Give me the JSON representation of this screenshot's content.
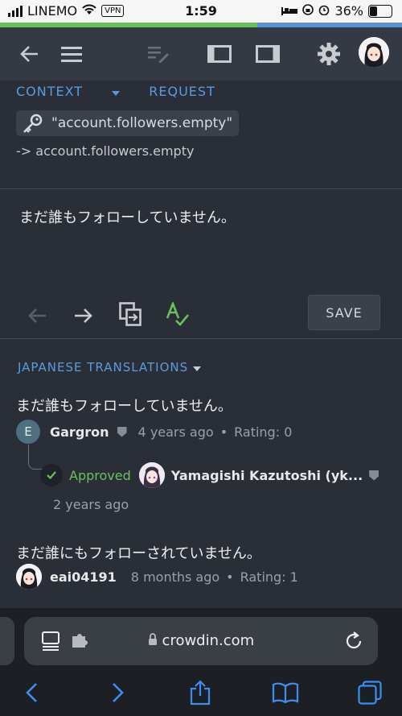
{
  "status": {
    "carrier": "LINEMO",
    "vpn": "VPN",
    "time": "1:59",
    "battery": "36%"
  },
  "progress": {
    "approved_fraction": 0.64
  },
  "sections": {
    "context": "CONTEXT",
    "request": "REQUEST"
  },
  "key": {
    "text": "\"account.followers.empty\""
  },
  "key_path": "-> account.followers.empty",
  "editor": {
    "text": "まだ誰もフォローしていません。",
    "save_label": "SAVE"
  },
  "translations": {
    "title": "JAPANESE TRANSLATIONS",
    "items": [
      {
        "text": "まだ誰もフォローしていません。",
        "avatar_letter": "E",
        "user": "Gargron",
        "when": "4 years ago",
        "rating": "Rating: 0",
        "approved_label": "Approved",
        "approver": "Yamagishi Kazutoshi (yk...",
        "approved_when": "2 years ago"
      },
      {
        "text": "まだ誰にもフォローされていません。",
        "user": "eai04191",
        "when": "8 months ago",
        "rating": "Rating: 1"
      }
    ]
  },
  "browser": {
    "url": "crowdin.com"
  },
  "icons": [
    "back-icon",
    "menu-icon",
    "edit-note-icon",
    "left-panel-icon",
    "right-panel-icon",
    "gear-icon",
    "key-icon",
    "arrow-left-icon",
    "arrow-right-icon",
    "copy-source-icon",
    "spellcheck-icon",
    "check-icon",
    "reader-icon",
    "extension-icon",
    "lock-icon",
    "reload-icon",
    "safari-back-icon",
    "safari-forward-icon",
    "share-icon",
    "bookmarks-icon",
    "tabs-icon"
  ],
  "colors": {
    "accent": "#5a9be0",
    "approved": "#6cbf5d",
    "background": "#2a2f37"
  }
}
